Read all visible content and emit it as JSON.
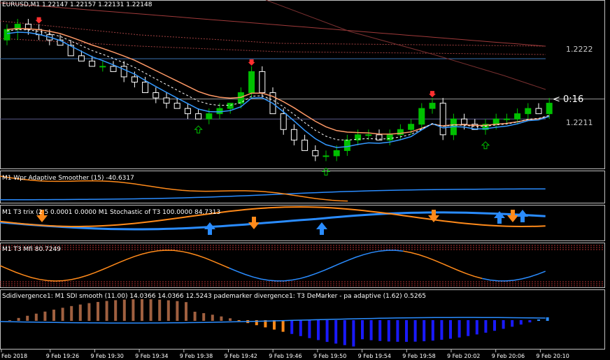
{
  "colors": {
    "background": "#000000",
    "bull": "#00c000",
    "bear": "#ffffff",
    "ema_fast": "#3399ff",
    "ema_slow": "#ff9966",
    "grid": "#404040",
    "orange": "#ff8a1a",
    "blue": "#2a8cff",
    "red": "#ff3030",
    "green": "#00c000",
    "dark_blue": "#1a1aff"
  },
  "icons": {
    "up_arrow": "up-arrow-icon",
    "down_arrow": "down-arrow-icon"
  },
  "main": {
    "header": "EURUSD,M1  1.22147 1.22157 1.22131 1.22148",
    "price_labels": [
      "1.2222",
      "1.2211"
    ],
    "countdown": "< 0:16"
  },
  "panels": {
    "wpr": {
      "header": "M1  Wpr Adaptive Smoother (15) -40.6317"
    },
    "t3": {
      "header": "M1  T3 trix (2  5 0.0001 0.0000  M1   Stochastic of T3 100.0000 84.7313"
    },
    "mfi": {
      "header": "M1  T3 Mfi  80.7249"
    },
    "sdi": {
      "header": "Sdidivergence1:  M1   SDI smooth (11.00) 14.0366 14.0366 12.5243  pademarker divergence1: T3 DeMarker - pa adaptive (1.62) 0.5265"
    }
  },
  "x_axis": {
    "labels": [
      "Feb 2018",
      "9 Feb 19:26",
      "9 Feb 19:30",
      "9 Feb 19:34",
      "9 Feb 19:38",
      "9 Feb 19:42",
      "9 Feb 19:46",
      "9 Feb 19:50",
      "9 Feb 19:54",
      "9 Feb 19:58",
      "9 Feb 20:02",
      "9 Feb 20:06",
      "9 Feb 20:10"
    ]
  },
  "chart_data": [
    {
      "type": "candlestick",
      "title": "EURUSD,M1",
      "ohlc_current": {
        "open": 1.22147,
        "high": 1.22157,
        "low": 1.22131,
        "close": 1.22148
      },
      "ylim": [
        1.2202,
        1.2232
      ],
      "candles": [
        [
          1.2226,
          1.2229,
          1.2225,
          1.2228
        ],
        [
          1.2228,
          1.223,
          1.2226,
          1.2229
        ],
        [
          1.2229,
          1.223,
          1.2227,
          1.2228
        ],
        [
          1.2228,
          1.2229,
          1.2226,
          1.2227
        ],
        [
          1.2227,
          1.2228,
          1.2225,
          1.2226
        ],
        [
          1.2226,
          1.2227,
          1.2225,
          1.2225
        ],
        [
          1.2225,
          1.2226,
          1.2223,
          1.2223
        ],
        [
          1.2223,
          1.2224,
          1.2222,
          1.2222
        ],
        [
          1.2222,
          1.2223,
          1.2221,
          1.2221
        ],
        [
          1.2221,
          1.2222,
          1.222,
          1.2221
        ],
        [
          1.2221,
          1.2222,
          1.222,
          1.222
        ],
        [
          1.2221,
          1.2222,
          1.2218,
          1.2219
        ],
        [
          1.2219,
          1.222,
          1.2217,
          1.2218
        ],
        [
          1.2218,
          1.2219,
          1.2216,
          1.2216
        ],
        [
          1.2216,
          1.2217,
          1.2214,
          1.2215
        ],
        [
          1.2215,
          1.2216,
          1.2213,
          1.2214
        ],
        [
          1.2214,
          1.2215,
          1.2213,
          1.2213
        ],
        [
          1.2213,
          1.2214,
          1.2211,
          1.2212
        ],
        [
          1.2212,
          1.2213,
          1.2211,
          1.2211
        ],
        [
          1.2211,
          1.2213,
          1.221,
          1.2212
        ],
        [
          1.2212,
          1.2214,
          1.2211,
          1.2213
        ],
        [
          1.2213,
          1.2214,
          1.2212,
          1.2214
        ],
        [
          1.2214,
          1.2217,
          1.2213,
          1.2216
        ],
        [
          1.2216,
          1.2221,
          1.2215,
          1.222
        ],
        [
          1.222,
          1.2221,
          1.2215,
          1.2216
        ],
        [
          1.2216,
          1.2217,
          1.2212,
          1.2212
        ],
        [
          1.2212,
          1.2213,
          1.2208,
          1.2209
        ],
        [
          1.2209,
          1.221,
          1.2206,
          1.2207
        ],
        [
          1.2207,
          1.2208,
          1.2205,
          1.2205
        ],
        [
          1.2205,
          1.2206,
          1.2203,
          1.2204
        ],
        [
          1.2204,
          1.2205,
          1.2203,
          1.2204
        ],
        [
          1.2204,
          1.2206,
          1.2203,
          1.2205
        ],
        [
          1.2205,
          1.2208,
          1.2204,
          1.2207
        ],
        [
          1.2207,
          1.2209,
          1.2206,
          1.2208
        ],
        [
          1.2208,
          1.2209,
          1.2207,
          1.2208
        ],
        [
          1.2208,
          1.2209,
          1.2207,
          1.2207
        ],
        [
          1.2207,
          1.2209,
          1.2206,
          1.2208
        ],
        [
          1.2208,
          1.221,
          1.2207,
          1.2209
        ],
        [
          1.2209,
          1.2211,
          1.2208,
          1.221
        ],
        [
          1.221,
          1.2214,
          1.2209,
          1.2213
        ],
        [
          1.2213,
          1.2215,
          1.2212,
          1.2214
        ],
        [
          1.2214,
          1.2215,
          1.2207,
          1.2208
        ],
        [
          1.2208,
          1.2212,
          1.2207,
          1.2211
        ],
        [
          1.2211,
          1.2212,
          1.2209,
          1.221
        ],
        [
          1.221,
          1.2211,
          1.2209,
          1.2209
        ],
        [
          1.2209,
          1.2211,
          1.2208,
          1.221
        ],
        [
          1.221,
          1.2212,
          1.2209,
          1.2211
        ],
        [
          1.2211,
          1.2212,
          1.221,
          1.2211
        ],
        [
          1.2211,
          1.2213,
          1.221,
          1.2212
        ],
        [
          1.2212,
          1.2214,
          1.2211,
          1.2213
        ],
        [
          1.2213,
          1.2214,
          1.2212,
          1.2212
        ],
        [
          1.2212,
          1.2215,
          1.2211,
          1.2214
        ]
      ]
    }
  ]
}
